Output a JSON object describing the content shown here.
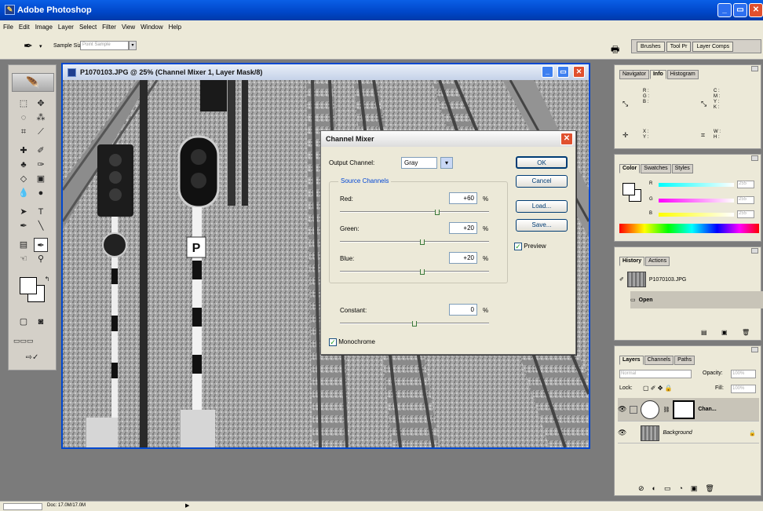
{
  "app": {
    "title": "Adobe Photoshop"
  },
  "menu": [
    "File",
    "Edit",
    "Image",
    "Layer",
    "Select",
    "Filter",
    "View",
    "Window",
    "Help"
  ],
  "options": {
    "sample_label": "Sample Size:",
    "sample_value": "Point Sample"
  },
  "palette_well": [
    "Brushes",
    "Tool Pr",
    "Layer Comps"
  ],
  "document": {
    "title": "P1070103.JPG @ 25% (Channel Mixer 1, Layer Mask/8)"
  },
  "channel_mixer": {
    "title": "Channel Mixer",
    "output_label": "Output Channel:",
    "output_value": "Gray",
    "group_label": "Source Channels",
    "red_label": "Red:",
    "red_value": "+60",
    "red_fraction": 0.65,
    "green_label": "Green:",
    "green_value": "+20",
    "green_fraction": 0.55,
    "blue_label": "Blue:",
    "blue_value": "+20",
    "blue_fraction": 0.55,
    "constant_label": "Constant:",
    "constant_value": "0",
    "constant_fraction": 0.5,
    "percent": "%",
    "ok": "OK",
    "cancel": "Cancel",
    "load": "Load...",
    "save": "Save...",
    "preview": "Preview",
    "monochrome": "Monochrome"
  },
  "navigator_panel": {
    "tabs": [
      "Navigator",
      "Info",
      "Histogram"
    ],
    "cmyk": "C :\nM :\nY :\nK :",
    "rgb": "R :\nG :\nB :",
    "xy": "X :\nY :",
    "wh": "W :\nH :"
  },
  "color_panel": {
    "tabs": [
      "Color",
      "Swatches",
      "Styles"
    ],
    "r": "R",
    "g": "G",
    "b": "B",
    "r_val": "255",
    "g_val": "255",
    "b_val": "255"
  },
  "history_panel": {
    "tabs": [
      "History",
      "Actions"
    ],
    "snapshot": "P1070103.JPG",
    "state": "Open"
  },
  "layers_panel": {
    "tabs": [
      "Layers",
      "Channels",
      "Paths"
    ],
    "blend": "Normal",
    "opacity_label": "Opacity:",
    "opacity": "100%",
    "lock_label": "Lock:",
    "fill_label": "Fill:",
    "fill": "100%",
    "layer1": "Chan...",
    "layer2": "Background"
  },
  "status": {
    "doc": "Doc: 17.0M/17.0M"
  }
}
